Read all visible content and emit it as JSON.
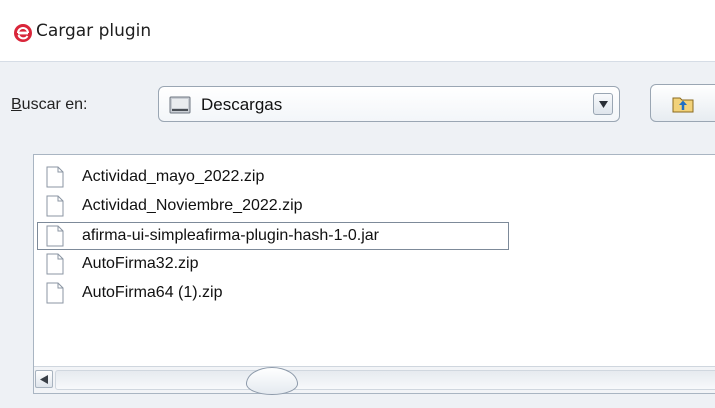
{
  "window": {
    "title": "Cargar plugin",
    "app_icon": "red-e-logo-icon"
  },
  "toolbar": {
    "look_in_label_mnemonic": "B",
    "look_in_label_rest": "uscar en:",
    "location": "Descargas",
    "location_icon": "drive-icon",
    "up_folder_icon": "up-folder-icon"
  },
  "files": [
    {
      "name": "Actividad_mayo_2022.zip"
    },
    {
      "name": "Actividad_Noviembre_2022.zip"
    },
    {
      "name": "afirma-ui-simpleafirma-plugin-hash-1-0.jar"
    },
    {
      "name": "AutoFirma32.zip"
    },
    {
      "name": "AutoFirma64 (1).zip"
    }
  ],
  "selected_file_index": 2,
  "colors": {
    "logo_red": "#d9263a",
    "dialog_bg": "#eef1f5"
  }
}
